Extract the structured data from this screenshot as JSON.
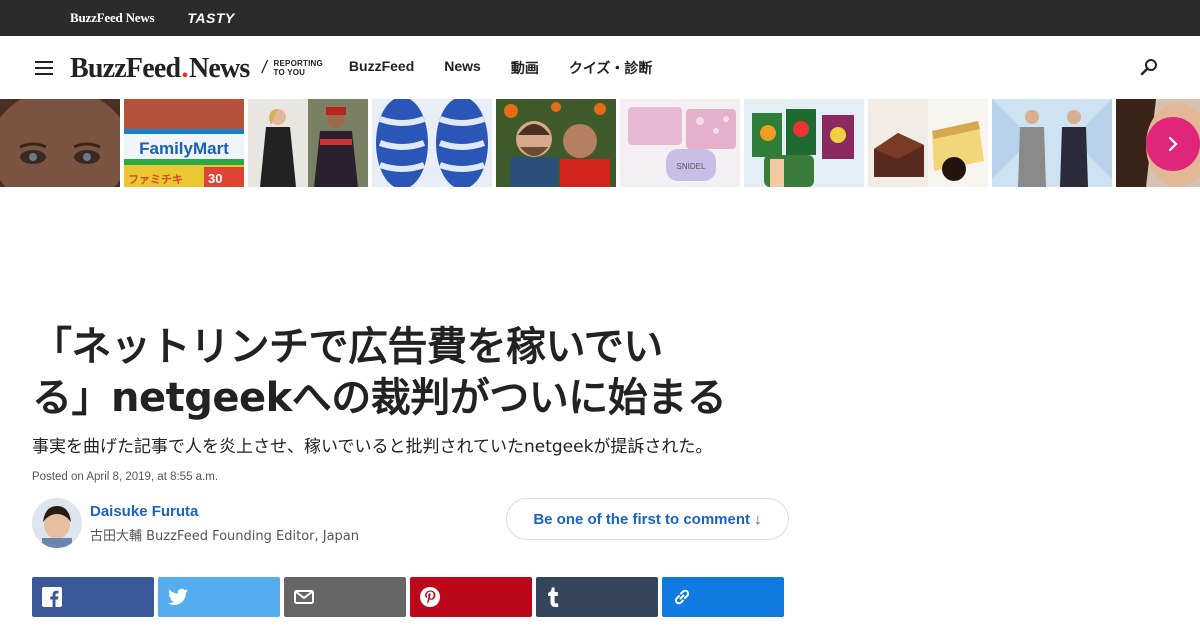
{
  "topbar": {
    "brand": "BuzzFeed News",
    "tasty": "TASTY"
  },
  "header": {
    "logo_main": "BuzzFeed",
    "logo_dot": ".",
    "logo_news": "News",
    "tagline_line1": "REPORTING",
    "tagline_line2": "TO YOU",
    "nav": [
      "BuzzFeed",
      "News",
      "動画",
      "クイズ・診断"
    ]
  },
  "icons": {
    "menu": "hamburger-menu-icon",
    "search": "search-icon",
    "next": "chevron-right-icon",
    "facebook": "facebook-icon",
    "twitter": "twitter-icon",
    "email": "email-icon",
    "pinterest": "pinterest-icon",
    "tumblr": "tumblr-icon",
    "link": "link-icon"
  },
  "strip": {
    "familymart_sign": "FamilyMart",
    "familymart_bottom": "ファミチキ",
    "familymart_price": "30",
    "snidel": "SNIDEL"
  },
  "article": {
    "headline_line1": "「ネットリンチで広告費を稼いでい",
    "headline_line2": "る」netgeekへの裁判がついに始まる",
    "subhead": "事実を曲げた記事で人を炎上させ、稼いでいると批判されていたnetgeekが提訴された。",
    "posted": "Posted on April 8, 2019, at 8:55 a.m.",
    "author_name": "Daisuke Furuta",
    "author_role": "古田大輔 BuzzFeed Founding Editor, Japan",
    "comment_label": "Be one of the first to comment ↓"
  },
  "colors": {
    "topbar": "#2b2b2b",
    "accent_pink": "#e0267a",
    "link_blue": "#1a63c6",
    "facebook": "#3b5998",
    "twitter": "#55acee",
    "email": "#666666",
    "pinterest": "#bd081c",
    "tumblr": "#35465c",
    "link": "#0f7be2"
  }
}
